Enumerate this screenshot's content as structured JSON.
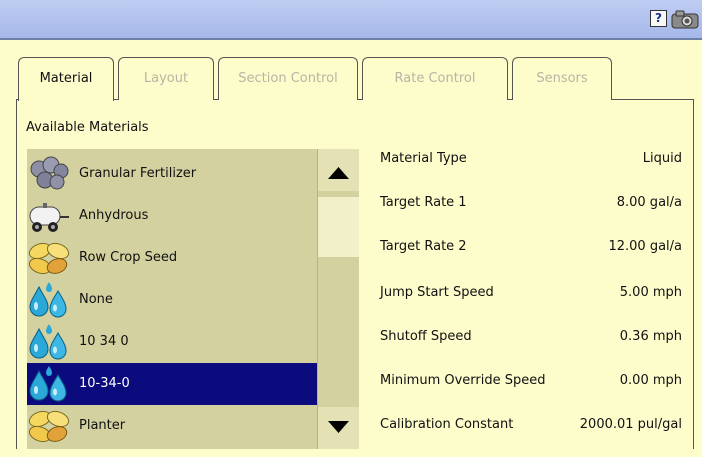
{
  "toolbar": {
    "help_label": "?",
    "help_icon": "help-icon",
    "camera_icon": "camera-icon"
  },
  "tabs": [
    {
      "label": "Material",
      "active": true
    },
    {
      "label": "Layout",
      "active": false
    },
    {
      "label": "Section Control",
      "active": false
    },
    {
      "label": "Rate Control",
      "active": false
    },
    {
      "label": "Sensors",
      "active": false
    }
  ],
  "available_materials_label": "Available Materials",
  "materials": [
    {
      "label": "Granular Fertilizer",
      "icon": "granular-fertilizer-icon"
    },
    {
      "label": "Anhydrous",
      "icon": "anhydrous-tank-icon"
    },
    {
      "label": "Row Crop Seed",
      "icon": "seed-icon"
    },
    {
      "label": "None",
      "icon": "liquid-drops-icon"
    },
    {
      "label": "10 34 0",
      "icon": "liquid-drops-icon"
    },
    {
      "label": "10-34-0",
      "icon": "liquid-drops-icon",
      "selected": true
    },
    {
      "label": "Planter",
      "icon": "seed-icon"
    }
  ],
  "properties": [
    {
      "label": "Material Type",
      "value": "Liquid"
    },
    {
      "label": "Target Rate 1",
      "value": "8.00 gal/a"
    },
    {
      "label": "Target Rate 2",
      "value": "12.00 gal/a"
    },
    {
      "label": "Jump Start Speed",
      "value": "5.00 mph"
    },
    {
      "label": "Shutoff Speed",
      "value": "0.36 mph"
    },
    {
      "label": "Minimum Override Speed",
      "value": "0.00 mph"
    },
    {
      "label": "Calibration Constant",
      "value": "2000.01 pul/gal"
    }
  ],
  "colors": {
    "background": "#fdfccb",
    "titlebar": "#a5b8ea",
    "list_background": "#d3d1a0",
    "selection": "#0b0b7e"
  }
}
